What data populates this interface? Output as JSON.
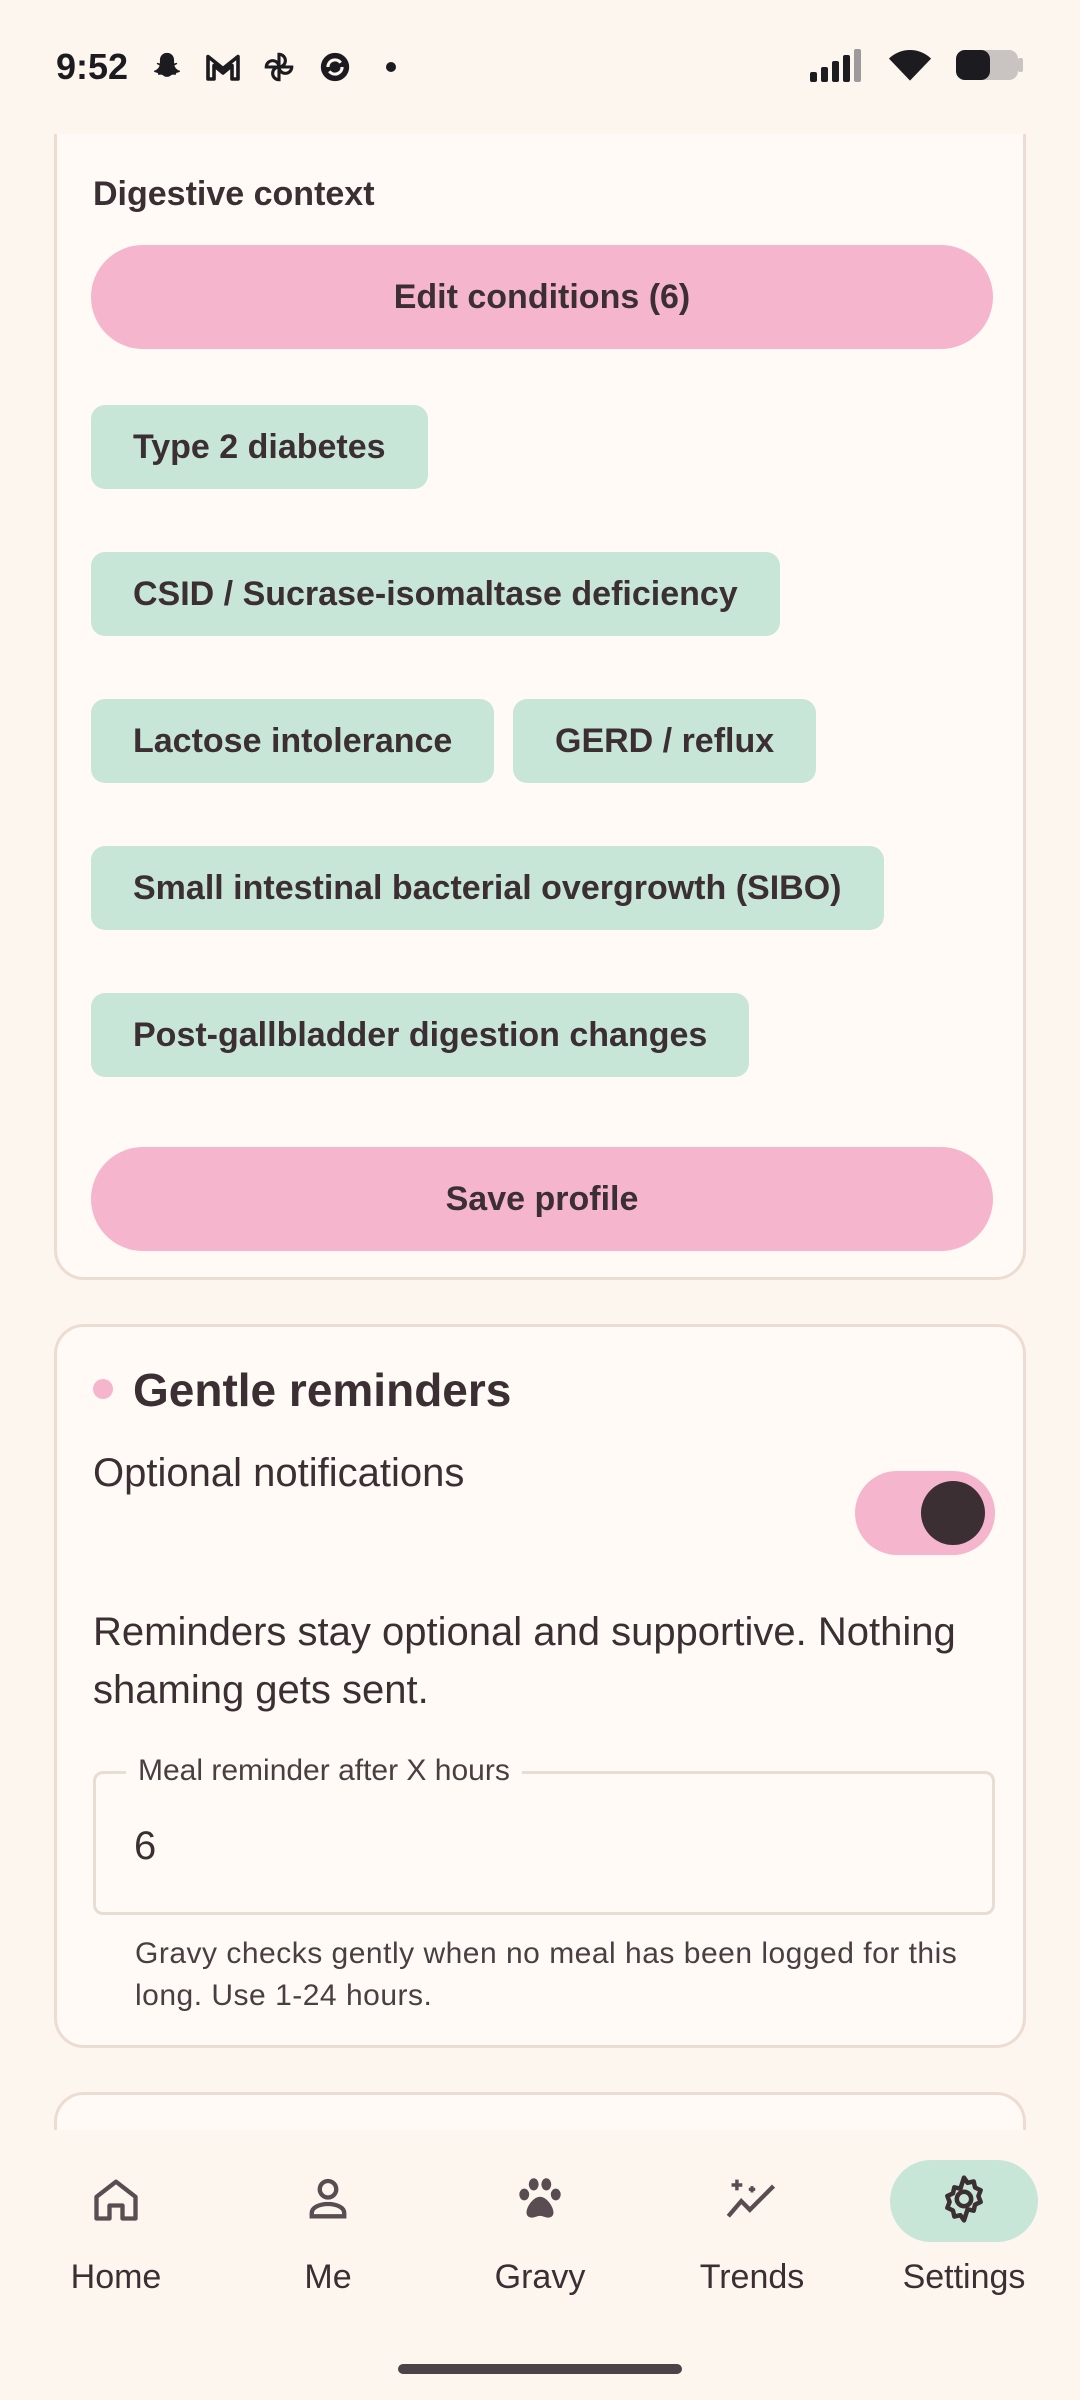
{
  "status_bar": {
    "time": "9:52",
    "left_icons": [
      "snapchat-icon",
      "gmail-icon",
      "pinwheel-icon",
      "sync-icon",
      "dot-icon"
    ],
    "right_icons": [
      "signal-icon",
      "wifi-icon",
      "battery-icon"
    ]
  },
  "profile_card": {
    "section_label": "Digestive context",
    "edit_button": "Edit conditions (6)",
    "conditions": [
      "Type 2 diabetes",
      "CSID / Sucrase-isomaltase deficiency",
      "Lactose intolerance",
      "GERD / reflux",
      "Small intestinal bacterial overgrowth (SIBO)",
      "Post-gallbladder digestion changes"
    ],
    "save_button": "Save profile"
  },
  "reminders_card": {
    "title": "Gentle reminders",
    "toggle_label": "Optional notifications",
    "toggle_on": true,
    "support_text": "Reminders stay optional and supportive. Nothing shaming gets sent.",
    "field_label": "Meal reminder after X hours",
    "field_value": "6",
    "helper_text": "Gravy checks gently when no meal has been logged for this long. Use 1-24 hours."
  },
  "bottom_nav": {
    "items": [
      {
        "label": "Home",
        "icon": "home-icon"
      },
      {
        "label": "Me",
        "icon": "person-icon"
      },
      {
        "label": "Gravy",
        "icon": "paw-icon"
      },
      {
        "label": "Trends",
        "icon": "trends-icon"
      },
      {
        "label": "Settings",
        "icon": "gear-icon"
      }
    ],
    "active": "Settings"
  },
  "colors": {
    "background": "#fdf6ef",
    "card": "#fffaf5",
    "accent_pink": "#f5b5cd",
    "chip_green": "#c8e6d8",
    "text": "#3b2f33"
  }
}
